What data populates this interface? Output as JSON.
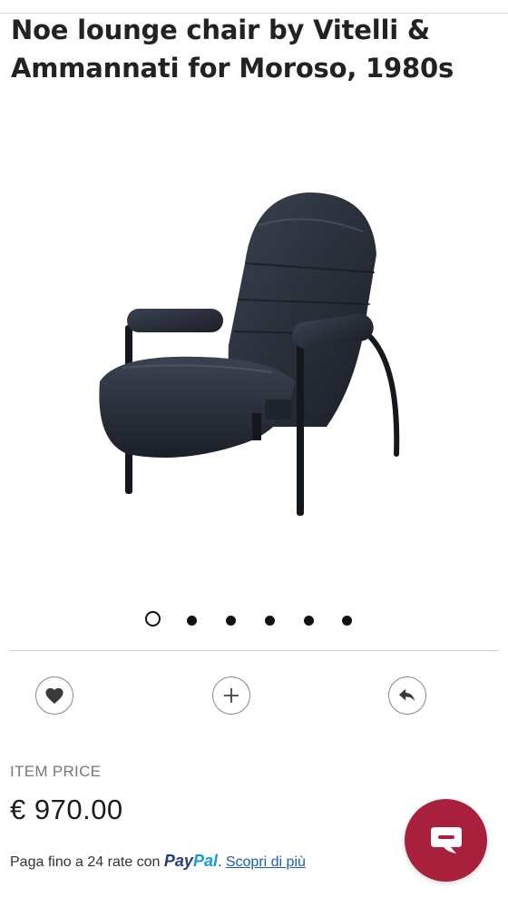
{
  "product": {
    "title_line1": "Noe lounge chair by Vitelli &",
    "title_line2": "Ammannati for Moroso, 1980s",
    "image_alt": "Black leather Noe lounge chair with tubular metal frame"
  },
  "gallery": {
    "slide_count": 6,
    "active_index": 0
  },
  "actions": {
    "favorite_icon": "heart-icon",
    "add_icon": "plus-icon",
    "share_icon": "share-arrow-icon"
  },
  "pricing": {
    "label": "ITEM PRICE",
    "value": "€ 970.00"
  },
  "paypal": {
    "text": "Paga fino a 24 rate con ",
    "brand_pay": "Pay",
    "brand_pal": "Pal",
    "separator": ". ",
    "link": "Scopri di più"
  },
  "chat": {
    "icon": "chat-bubble-icon",
    "color": "#a8203c"
  }
}
